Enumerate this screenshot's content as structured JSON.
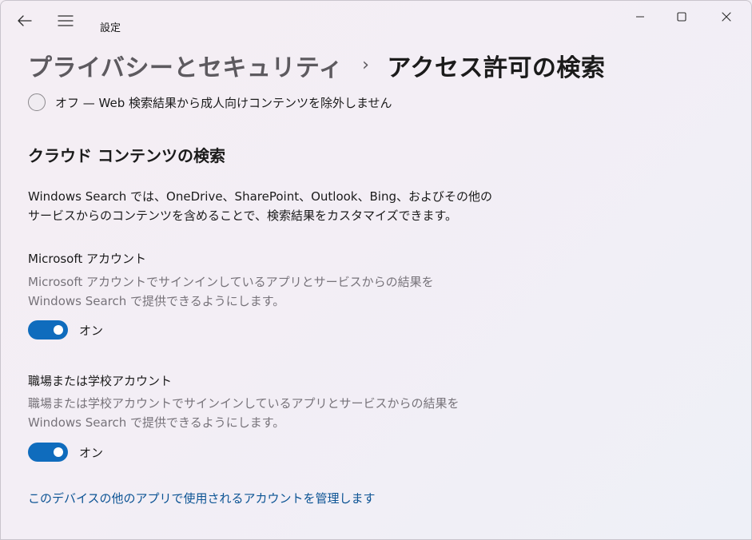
{
  "titlebar": {
    "app_title": "設定",
    "back_icon": "back-arrow-icon",
    "menu_icon": "hamburger-menu-icon",
    "window_controls": [
      "minimize-icon",
      "maximize-icon",
      "close-icon"
    ]
  },
  "breadcrumb": {
    "parent": "プライバシーとセキュリティ",
    "separator": "›",
    "current": "アクセス許可の検索"
  },
  "safesearch": {
    "off_option_label": "オフ — Web 検索結果から成人向けコンテンツを除外しません",
    "selected": false
  },
  "cloud_search": {
    "title": "クラウド コンテンツの検索",
    "description": "Windows Search では、OneDrive、SharePoint、Outlook、Bing、およびその他のサービスからのコンテンツを含めることで、検索結果をカスタマイズできます。",
    "microsoft_account": {
      "label": "Microsoft アカウント",
      "description": "Microsoft アカウントでサインインしているアプリとサービスからの結果を Windows Search で提供できるようにします。",
      "toggle_on": true,
      "toggle_text": "オン"
    },
    "work_school_account": {
      "label": "職場または学校アカウント",
      "description": "職場または学校アカウントでサインインしているアプリとサービスからの結果を Windows Search で提供できるようにします。",
      "toggle_on": true,
      "toggle_text": "オン"
    },
    "manage_link": "このデバイスの他のアプリで使用されるアカウントを管理します"
  },
  "colors": {
    "accent": "#0f6cbd",
    "link": "#0b5394",
    "secondary_text": "#77737a"
  }
}
